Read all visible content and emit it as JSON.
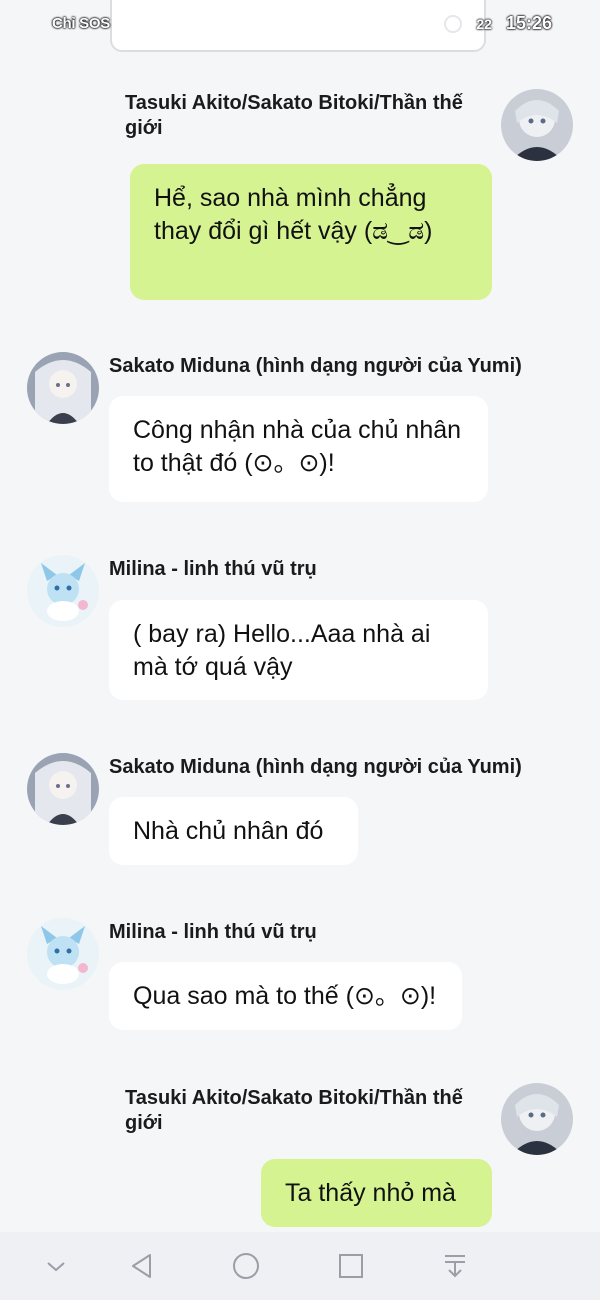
{
  "status_bar": {
    "carrier": "Chỉ SOS",
    "battery": "22",
    "time": "15:26"
  },
  "colors": {
    "background": "#f5f6f8",
    "incoming_bubble": "#ffffff",
    "outgoing_bubble": "#d6f391"
  },
  "messages": [
    {
      "sender": "Tasuki Akito/Sakato Bitoki/Thần thế giới",
      "text": "Hể, sao nhà mình chẳng thay đổi gì hết vậy (ಡ‿ಡ)",
      "direction": "outgoing"
    },
    {
      "sender": "Sakato Miduna (hình dạng người của Yumi)",
      "text": "Công nhận nhà của chủ nhân to thật đó (⊙。⊙)!",
      "direction": "incoming"
    },
    {
      "sender": "Milina - linh thú vũ trụ",
      "text": "( bay ra) Hello...Aaa nhà ai mà tớ quá vậy",
      "direction": "incoming"
    },
    {
      "sender": "Sakato Miduna (hình dạng người của Yumi)",
      "text": "Nhà chủ nhân đó",
      "direction": "incoming"
    },
    {
      "sender": "Milina - linh thú vũ trụ",
      "text": "Qua sao mà to thế (⊙。⊙)!",
      "direction": "incoming"
    },
    {
      "sender": "Tasuki Akito/Sakato Bitoki/Thần thế giới",
      "text": "Ta thấy nhỏ mà",
      "direction": "outgoing"
    }
  ],
  "nav_bar": {
    "icons": [
      "chevron-down-icon",
      "back-icon",
      "home-icon",
      "recents-icon",
      "download-icon"
    ]
  }
}
